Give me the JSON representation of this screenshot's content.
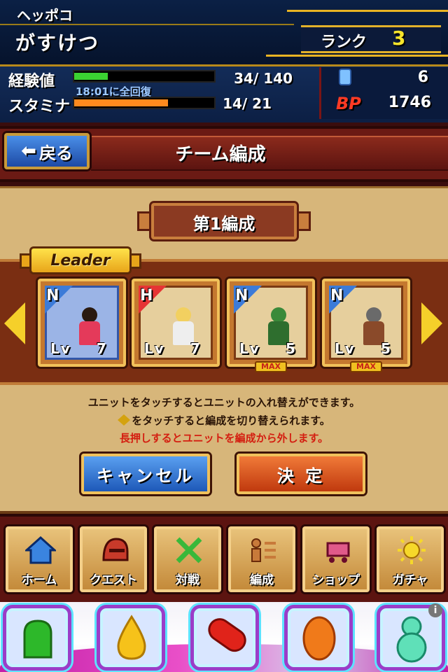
{
  "header": {
    "player_title": "ヘッポコ",
    "player_name": "がすけつ",
    "rank_label": "ランク",
    "rank_value": "3"
  },
  "status": {
    "exp_label": "経験値",
    "exp_value": "34/ 140",
    "exp_progress": 0.24,
    "stamina_label": "スタミナ",
    "stamina_value": "14/ 21",
    "stamina_progress": 0.67,
    "recover_text": "18:01に全回復",
    "gem_count": "6",
    "bp_label": "BP",
    "bp_value": "1746"
  },
  "navbar": {
    "back_label": "戻る",
    "page_title": "チーム編成"
  },
  "formation": {
    "title": "第1編成",
    "leader_label": "Leader",
    "slots": [
      {
        "rarity": "N",
        "level_prefix": "Lv",
        "level": "7",
        "max": false
      },
      {
        "rarity": "H",
        "level_prefix": "Lv",
        "level": "7",
        "max": false
      },
      {
        "rarity": "N",
        "level_prefix": "Lv",
        "level": "5",
        "max": true
      },
      {
        "rarity": "N",
        "level_prefix": "Lv",
        "level": "5",
        "max": true
      }
    ],
    "max_label": "MAX"
  },
  "instructions": {
    "line1": "ユニットをタッチするとユニットの入れ替えができます。",
    "line2": "をタッチすると編成を切り替えられます。",
    "line3": "長押しするとユニットを編成から外します。"
  },
  "actions": {
    "cancel_label": "キャンセル",
    "confirm_label": "決 定"
  },
  "menu": {
    "items": [
      {
        "label": "ホーム",
        "icon": "house-icon"
      },
      {
        "label": "クエスト",
        "icon": "helmet-icon"
      },
      {
        "label": "対戦",
        "icon": "crossed-swords-icon"
      },
      {
        "label": "編成",
        "icon": "formation-icon"
      },
      {
        "label": "ショップ",
        "icon": "cart-icon"
      },
      {
        "label": "ガチャ",
        "icon": "sun-icon"
      }
    ]
  },
  "ad": {
    "info_label": "i"
  },
  "colors": {
    "exp_bar": "#3bd232",
    "stamina_bar": "#ff8a1e",
    "rank_value": "#f6e42b",
    "warning_text": "#d41e10"
  }
}
